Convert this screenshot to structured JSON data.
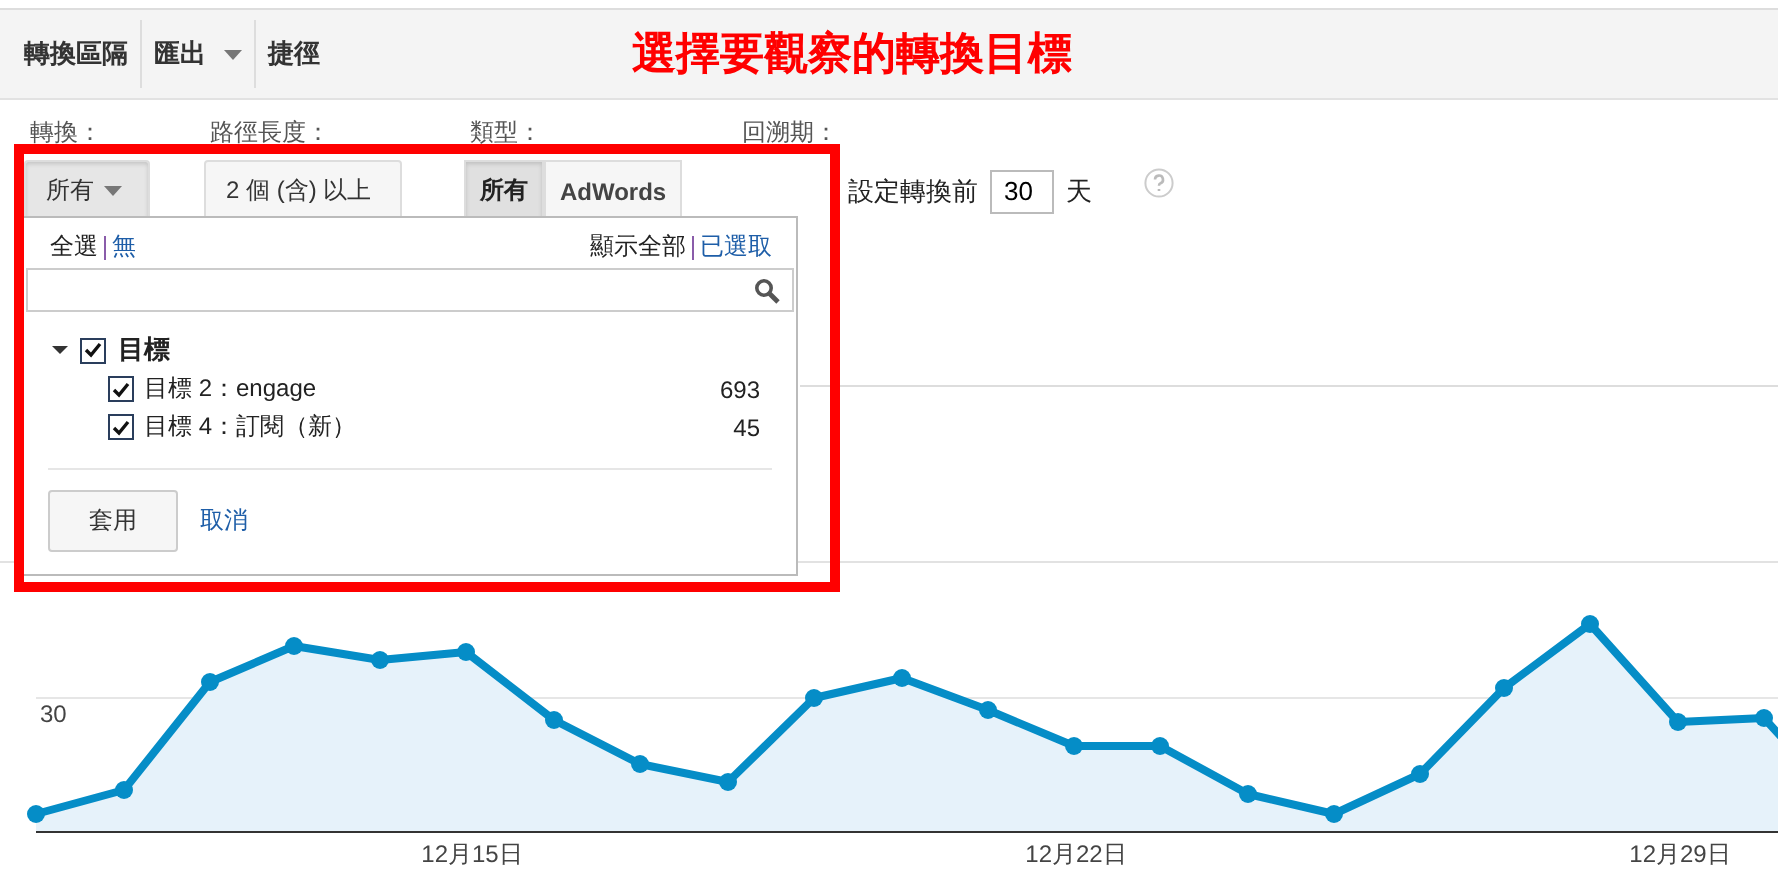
{
  "toolbar": {
    "items": [
      {
        "label": "轉換區隔",
        "dropdown": false
      },
      {
        "label": "匯出",
        "dropdown": true
      },
      {
        "label": "捷徑",
        "dropdown": false
      }
    ]
  },
  "annotation": "選擇要觀察的轉換目標",
  "filters": {
    "conversion": {
      "label": "轉換：",
      "value": "所有"
    },
    "path_length": {
      "label": "路徑長度：",
      "value": "2 個 (含) 以上"
    },
    "type": {
      "label": "類型：",
      "options": [
        {
          "label": "所有",
          "selected": true
        },
        {
          "label": "AdWords",
          "selected": false
        }
      ]
    },
    "lookback": {
      "label": "回溯期：",
      "prefix": "設定轉換前",
      "value": "30",
      "suffix": "天"
    }
  },
  "dropdown": {
    "select_all": "全選",
    "select_none": "無",
    "show_all": "顯示全部",
    "show_selected": "已選取",
    "group": {
      "label": "目標",
      "expanded": true,
      "checked": true,
      "children": [
        {
          "label": "目標 2：engage",
          "count": "693",
          "checked": true
        },
        {
          "label": "目標 4：訂閱（新）",
          "count": "45",
          "checked": true
        }
      ]
    },
    "apply": "套用",
    "cancel": "取消"
  },
  "chart": {
    "y_label": "30",
    "x_labels": [
      "12月15日",
      "12月22日",
      "12月29日"
    ]
  }
}
